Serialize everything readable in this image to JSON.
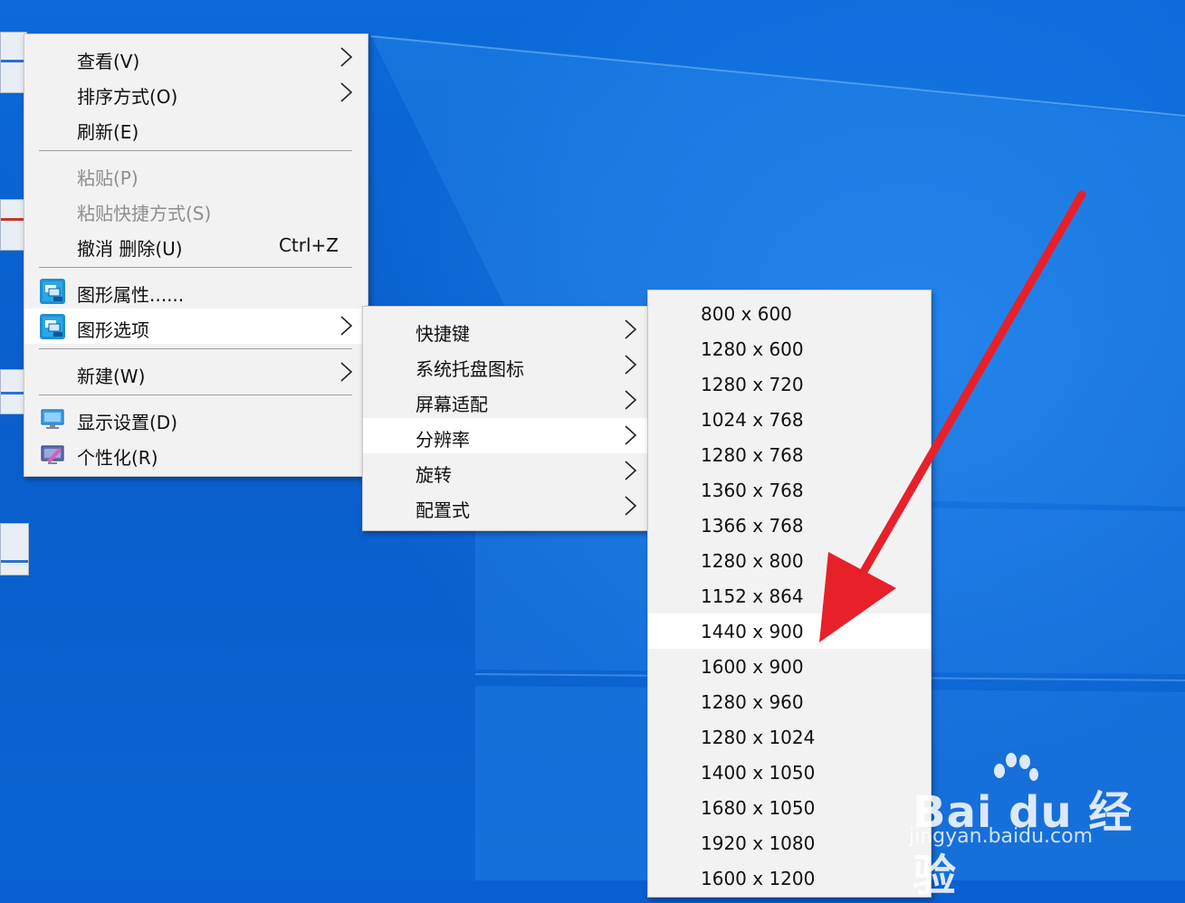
{
  "context_menu": {
    "items": [
      {
        "label": "查看(V)"
      },
      {
        "label": "排序方式(O)"
      },
      {
        "label": "刷新(E)"
      },
      {
        "label": "粘贴(P)"
      },
      {
        "label": "粘贴快捷方式(S)"
      },
      {
        "label": "撤消 删除(U)",
        "shortcut": "Ctrl+Z"
      },
      {
        "label": "图形属性......",
        "icon": "intel-graphics-icon"
      },
      {
        "label": "图形选项",
        "icon": "intel-graphics-icon"
      },
      {
        "label": "新建(W)"
      },
      {
        "label": "显示设置(D)",
        "icon": "display-settings-icon"
      },
      {
        "label": "个性化(R)",
        "icon": "personalize-icon"
      }
    ]
  },
  "graphics_submenu": {
    "items": [
      {
        "label": "快捷键"
      },
      {
        "label": "系统托盘图标"
      },
      {
        "label": "屏幕适配"
      },
      {
        "label": "分辨率"
      },
      {
        "label": "旋转"
      },
      {
        "label": "配置式"
      }
    ]
  },
  "resolution_submenu": {
    "items": [
      {
        "label": "800 x 600"
      },
      {
        "label": "1280 x 600"
      },
      {
        "label": "1280 x 720"
      },
      {
        "label": "1024 x 768"
      },
      {
        "label": "1280 x 768"
      },
      {
        "label": "1360 x 768"
      },
      {
        "label": "1366 x 768"
      },
      {
        "label": "1280 x 800"
      },
      {
        "label": "1152 x 864"
      },
      {
        "label": "1440 x 900"
      },
      {
        "label": "1600 x 900"
      },
      {
        "label": "1280 x 960"
      },
      {
        "label": "1280 x 1024"
      },
      {
        "label": "1400 x 1050"
      },
      {
        "label": "1680 x 1050"
      },
      {
        "label": "1920 x 1080"
      },
      {
        "label": "1600 x 1200"
      }
    ]
  },
  "watermark": {
    "brand": "Bai du 经验",
    "url": "jingyan.baidu.com"
  },
  "colors": {
    "menu_bg": "#f2f2f2",
    "highlight": "#ffffff",
    "arrow": "#e8202a",
    "desktop": "#0a5fd0"
  }
}
